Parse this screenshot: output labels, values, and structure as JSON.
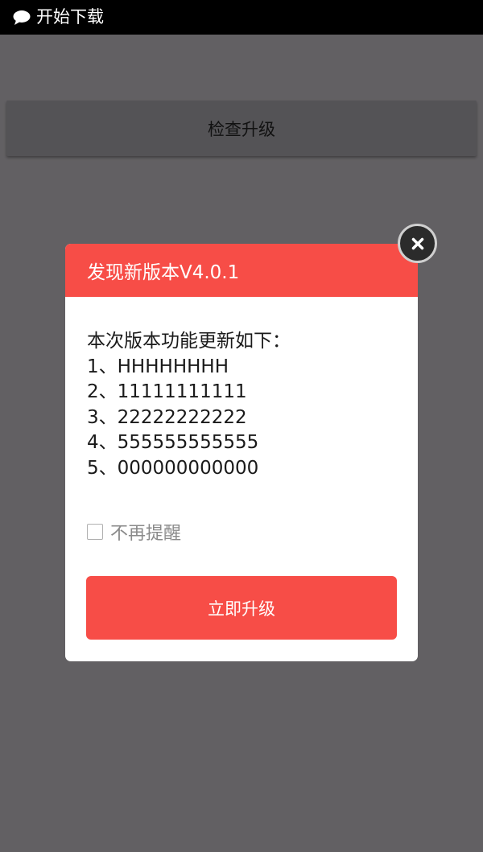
{
  "status_bar": {
    "icon": "chat-bubble-icon",
    "text": "开始下载"
  },
  "main": {
    "check_update_label": "检查升级"
  },
  "dialog": {
    "title": "发现新版本V4.0.1",
    "notes_heading": "本次版本功能更新如下：",
    "notes": [
      "1、HHHHHHHH",
      "2、11111111111",
      "3、22222222222",
      "4、555555555555",
      "5、000000000000"
    ],
    "remind_label": "不再提醒",
    "remind_checked": false,
    "upgrade_label": "立即升级",
    "close_icon": "close-icon"
  },
  "colors": {
    "accent": "#f74d47",
    "overlay": "#626063",
    "status_bar": "#000000"
  }
}
